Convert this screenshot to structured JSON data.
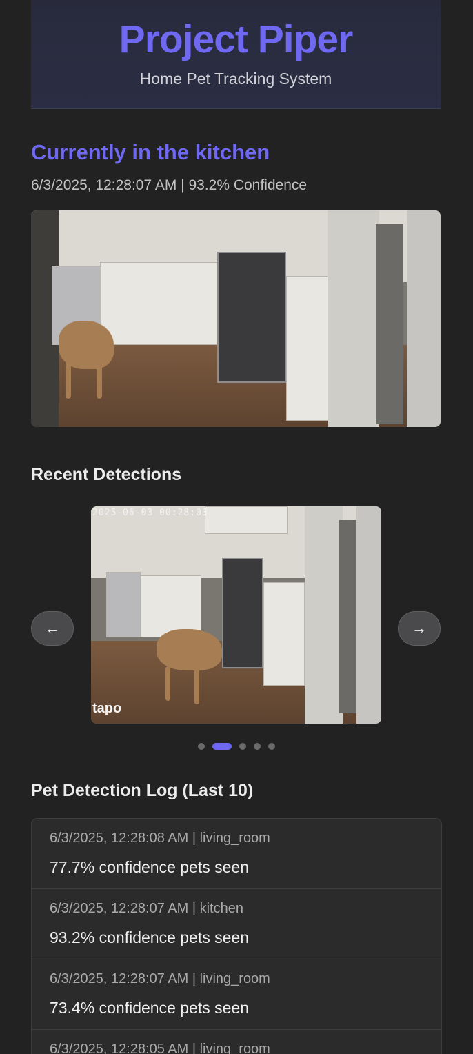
{
  "header": {
    "title": "Project Piper",
    "subtitle": "Home Pet Tracking System"
  },
  "current": {
    "heading": "Currently in the kitchen",
    "meta": "6/3/2025, 12:28:07 AM | 93.2% Confidence"
  },
  "recent": {
    "heading": "Recent Detections",
    "prev_icon": "arrow-left-icon",
    "next_icon": "arrow-right-icon",
    "prev_glyph": "←",
    "next_glyph": "→",
    "slide": {
      "timestamp": "2025-06-03 00:28:03",
      "brand": "tapo"
    },
    "dots_count": 5,
    "active_dot": 1
  },
  "log": {
    "heading": "Pet Detection Log (Last 10)",
    "items": [
      {
        "meta": "6/3/2025, 12:28:08 AM | living_room",
        "text": "77.7% confidence pets seen"
      },
      {
        "meta": "6/3/2025, 12:28:07 AM | kitchen",
        "text": "93.2% confidence pets seen"
      },
      {
        "meta": "6/3/2025, 12:28:07 AM | living_room",
        "text": "73.4% confidence pets seen"
      },
      {
        "meta": "6/3/2025, 12:28:05 AM | living_room",
        "text": ""
      }
    ]
  },
  "colors": {
    "accent": "#6f68f0",
    "background": "#222222"
  }
}
